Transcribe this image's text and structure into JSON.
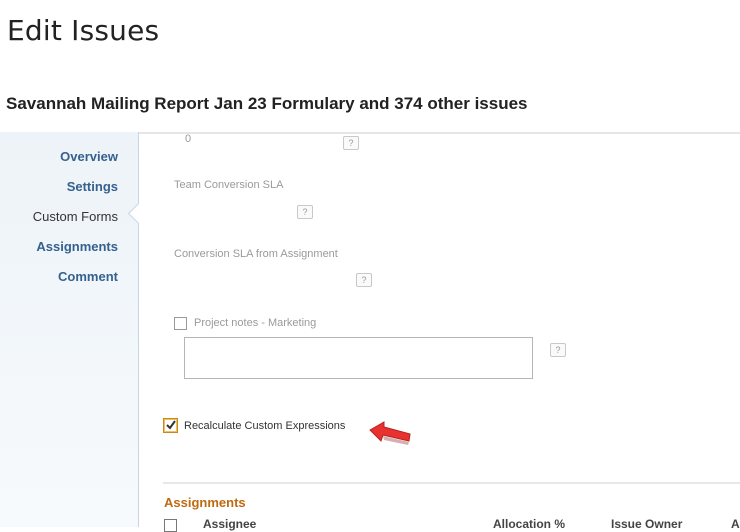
{
  "page": {
    "title": "Edit Issues",
    "subtitle": "Savannah Mailing Report Jan 23 Formulary and 374 other issues"
  },
  "sidebar": {
    "items": [
      {
        "label": "Overview"
      },
      {
        "label": "Settings"
      },
      {
        "label": "Custom Forms"
      },
      {
        "label": "Assignments"
      },
      {
        "label": "Comment"
      }
    ],
    "active": "Custom Forms"
  },
  "form": {
    "top_value": "0",
    "help_label": "?",
    "team_conversion_sla": {
      "label": "Team Conversion SLA"
    },
    "conversion_sla_from_assignment": {
      "label": "Conversion SLA from Assignment"
    },
    "project_notes": {
      "label": "Project notes - Marketing",
      "checked": false,
      "value": ""
    },
    "recalculate": {
      "label": "Recalculate Custom Expressions",
      "checked": true
    }
  },
  "assignments": {
    "title": "Assignments",
    "columns": [
      "Assignee",
      "Allocation %",
      "Issue Owner",
      "A"
    ]
  },
  "colors": {
    "link": "#35618f",
    "section_accent": "#c06a10",
    "checkbox_checked_border": "#c98a1a",
    "pointer_arrow": "#e8322f"
  },
  "icons": {
    "help": "question-mark-icon",
    "pointer": "red-arrow-pointer-icon",
    "check": "checkmark-icon"
  }
}
